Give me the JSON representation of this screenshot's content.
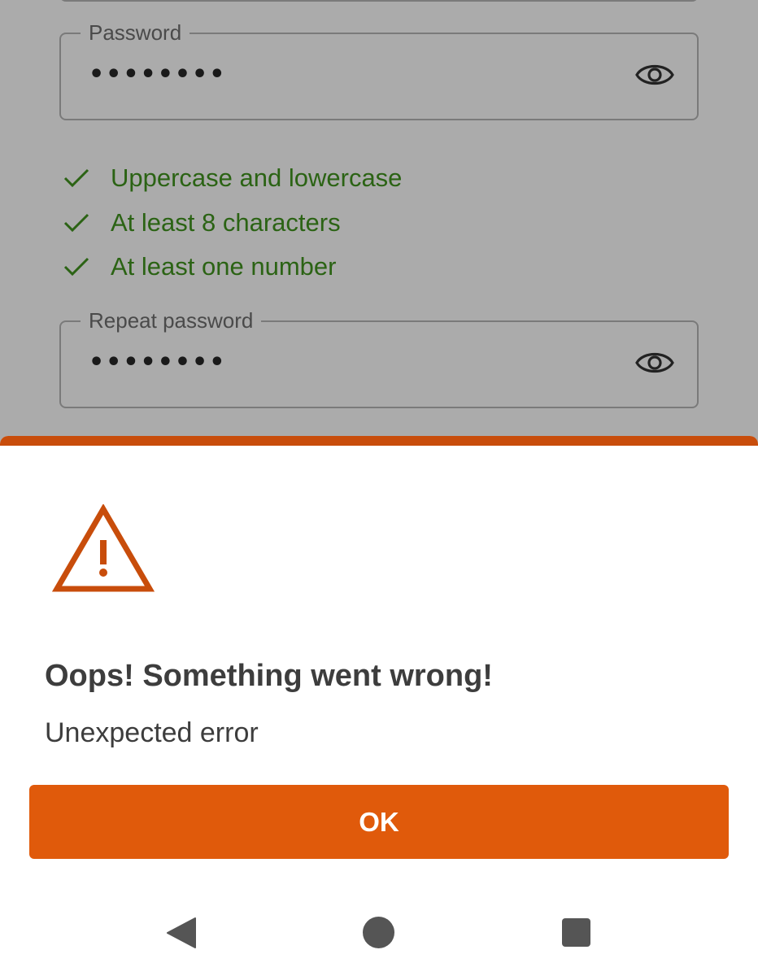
{
  "form": {
    "password": {
      "label": "Password",
      "value": "••••••••",
      "toggle_icon": "eye-icon"
    },
    "rules": [
      {
        "text": "Uppercase and lowercase",
        "icon": "check-icon",
        "satisfied": true
      },
      {
        "text": "At least 8 characters",
        "icon": "check-icon",
        "satisfied": true
      },
      {
        "text": "At least one number",
        "icon": "check-icon",
        "satisfied": true
      }
    ],
    "repeat_password": {
      "label": "Repeat password",
      "value": "••••••••",
      "toggle_icon": "eye-icon"
    }
  },
  "dialog": {
    "icon": "warning-icon",
    "title": "Oops! Something went wrong!",
    "message": "Unexpected error",
    "ok_label": "OK"
  },
  "nav_bar": {
    "items": [
      "back-icon",
      "home-icon",
      "recents-icon"
    ]
  },
  "colors": {
    "accent": "#e05a0b",
    "accent_dark": "#c84d0b",
    "success": "#2b6314",
    "scrim": "#ababab"
  }
}
